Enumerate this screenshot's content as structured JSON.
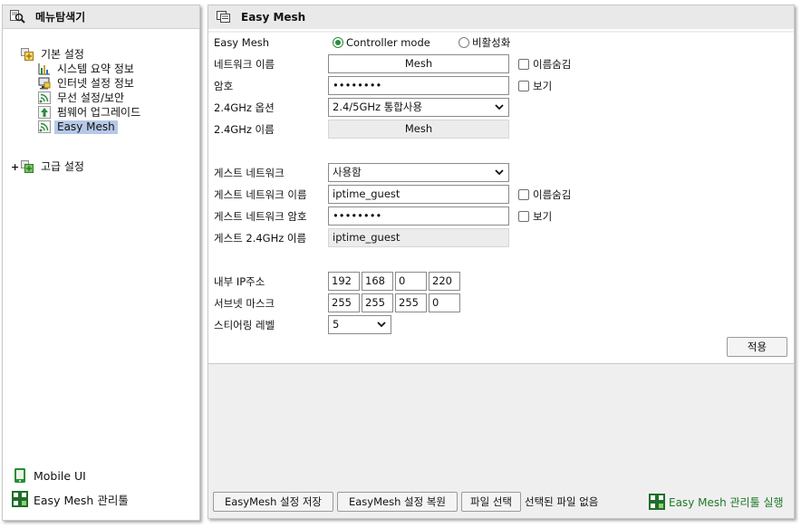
{
  "left": {
    "header": "메뉴탐색기",
    "tree": {
      "basic": {
        "label": "기본 설정",
        "expander": "",
        "children": [
          {
            "label": "시스템 요약 정보"
          },
          {
            "label": "인터넷 설정 정보"
          },
          {
            "label": "무선 설정/보안"
          },
          {
            "label": "펌웨어 업그레이드"
          },
          {
            "label": "Easy Mesh"
          }
        ]
      },
      "advanced": {
        "label": "고급 설정",
        "expander": "+"
      }
    },
    "bottom": {
      "mobile_ui": "Mobile UI",
      "mesh_manager": "Easy Mesh 관리툴"
    }
  },
  "main": {
    "header": "Easy Mesh",
    "easy_mesh_label": "Easy Mesh",
    "mode": {
      "controller": "Controller mode",
      "disabled": "비활성화",
      "selected": "controller"
    },
    "network_name": {
      "label": "네트워크 이름",
      "value": "Mesh",
      "hide_label": "이름숨김"
    },
    "password": {
      "label": "암호",
      "value": "••••••••",
      "show_label": "보기"
    },
    "option_24": {
      "label": "2.4GHz 옵션",
      "value": "2.4/5GHz 통합사용"
    },
    "name_24": {
      "label": "2.4GHz 이름",
      "value": "Mesh"
    },
    "guest_network": {
      "label": "게스트 네트워크",
      "value": "사용함"
    },
    "guest_name": {
      "label": "게스트 네트워크 이름",
      "value": "iptime_guest",
      "hide_label": "이름숨김"
    },
    "guest_password": {
      "label": "게스트 네트워크 암호",
      "value": "••••••••",
      "show_label": "보기"
    },
    "guest_name_24": {
      "label": "게스트 2.4GHz 이름",
      "value": "iptime_guest"
    },
    "internal_ip": {
      "label": "내부 IP주소",
      "octets": [
        "192",
        "168",
        "0",
        "220"
      ]
    },
    "subnet": {
      "label": "서브넷 마스크",
      "octets": [
        "255",
        "255",
        "255",
        "0"
      ]
    },
    "steering": {
      "label": "스티어링 레벨",
      "value": "5"
    },
    "apply": "적용",
    "bottom": {
      "save": "EasyMesh 설정 저장",
      "restore": "EasyMesh 설정 복원",
      "choose_file": "파일 선택",
      "no_file": "선택된 파일 없음",
      "run_manager": "Easy Mesh 관리툴 실행"
    }
  },
  "colors": {
    "selected_bg": "#b6c8e8",
    "accent_green": "#2a8c3a",
    "link_green": "#1f7a2a"
  }
}
